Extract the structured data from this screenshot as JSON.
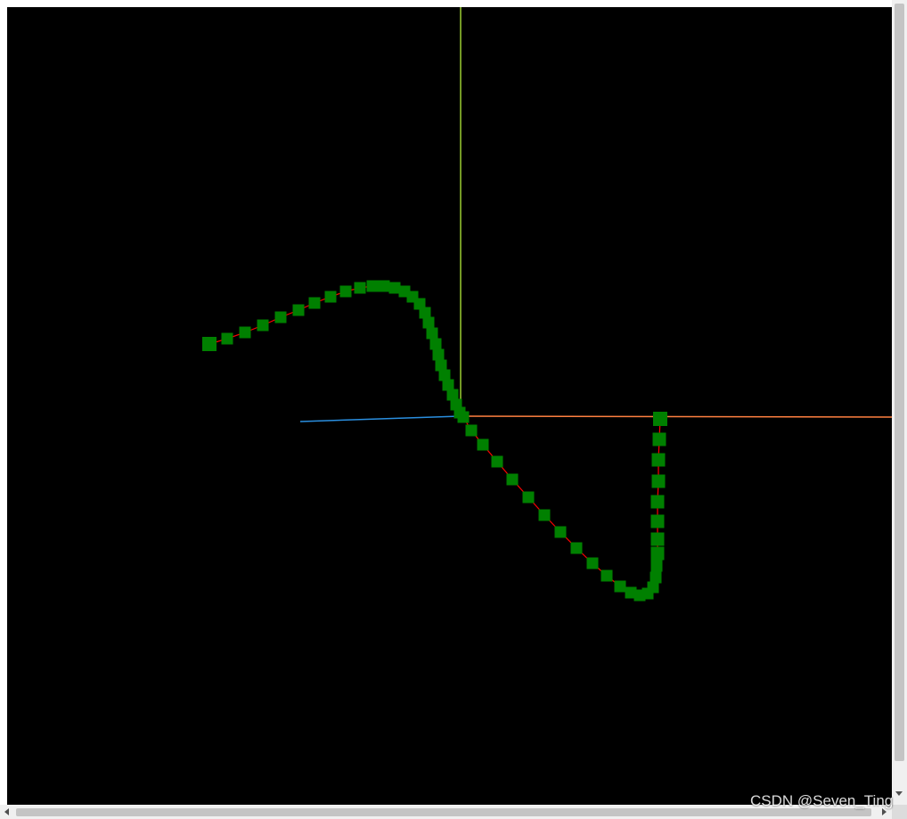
{
  "colors": {
    "background": "#000000",
    "curve_line": "#ff0000",
    "marker": "#008000",
    "x_axis": "#ff8040",
    "y_axis": "#aaff00",
    "z_axis": "#1e90ff"
  },
  "scene": {
    "marker_count": 60,
    "curve": "sine-like spline drawn in 3D with square point markers",
    "axes": [
      "x-axis",
      "y-axis",
      "z-axis"
    ]
  },
  "watermark": {
    "text": "CSDN @Seven_Ting"
  }
}
